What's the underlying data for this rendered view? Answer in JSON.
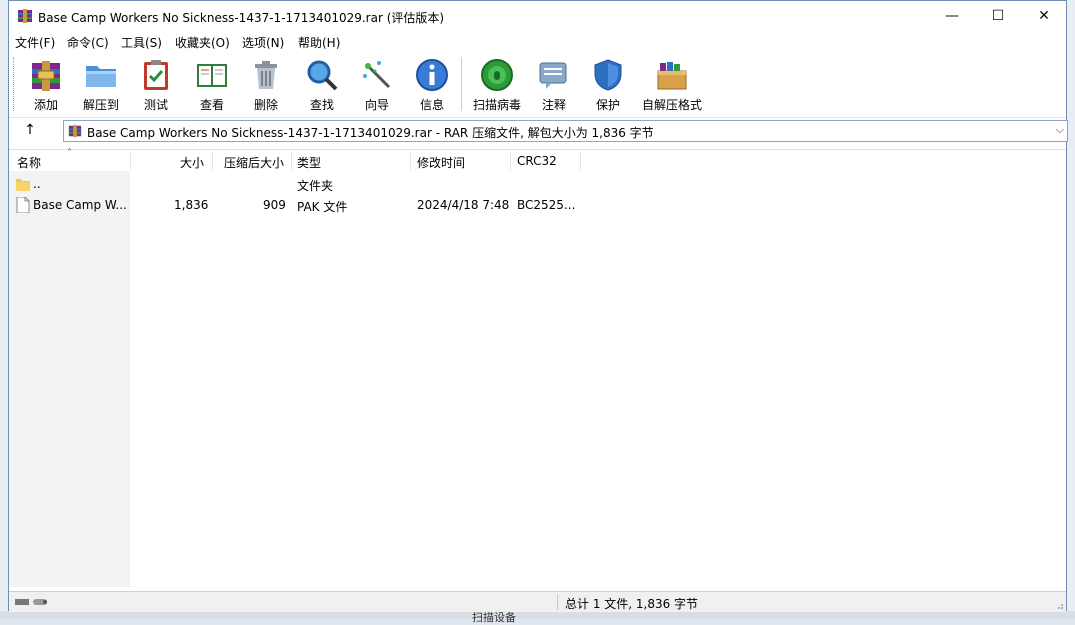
{
  "window": {
    "title": "Base Camp Workers No Sickness-1437-1-1713401029.rar (评估版本)",
    "controls": {
      "minimize": "—",
      "maximize": "☐",
      "close": "✕"
    }
  },
  "menu": [
    "文件(F)",
    "命令(C)",
    "工具(S)",
    "收藏夹(O)",
    "选项(N)",
    "帮助(H)"
  ],
  "toolbar": [
    {
      "label": "添加",
      "icon": "add-archive-icon"
    },
    {
      "label": "解压到",
      "icon": "extract-folder-icon"
    },
    {
      "label": "测试",
      "icon": "test-clipboard-icon"
    },
    {
      "label": "查看",
      "icon": "view-book-icon"
    },
    {
      "label": "删除",
      "icon": "trash-can-icon"
    },
    {
      "label": "查找",
      "icon": "magnifier-icon"
    },
    {
      "label": "向导",
      "icon": "magic-wand-icon"
    },
    {
      "label": "信息",
      "icon": "info-icon"
    },
    {
      "label": "扫描病毒",
      "icon": "virus-scan-icon"
    },
    {
      "label": "注释",
      "icon": "comment-icon"
    },
    {
      "label": "保护",
      "icon": "shield-icon"
    },
    {
      "label": "自解压格式",
      "icon": "sfx-box-icon"
    }
  ],
  "address": {
    "up_label": "↑",
    "path": "Base Camp Workers No Sickness-1437-1-1713401029.rar - RAR 压缩文件, 解包大小为 1,836 字节",
    "dropdown": "⌵"
  },
  "columns": [
    "名称",
    "大小",
    "压缩后大小",
    "类型",
    "修改时间",
    "CRC32"
  ],
  "sort_indicator": "˄",
  "rows": [
    {
      "name": "..",
      "size": "",
      "packed": "",
      "type": "文件夹",
      "modified": "",
      "crc": ""
    },
    {
      "name": "Base Camp W...",
      "size": "1,836",
      "packed": "909",
      "type": "PAK 文件",
      "modified": "2024/4/18 7:48",
      "crc": "BC2525..."
    }
  ],
  "status": {
    "summary": "总计 1 文件, 1,836 字节"
  },
  "background": {
    "bottom_fragment": "扫描设备"
  }
}
